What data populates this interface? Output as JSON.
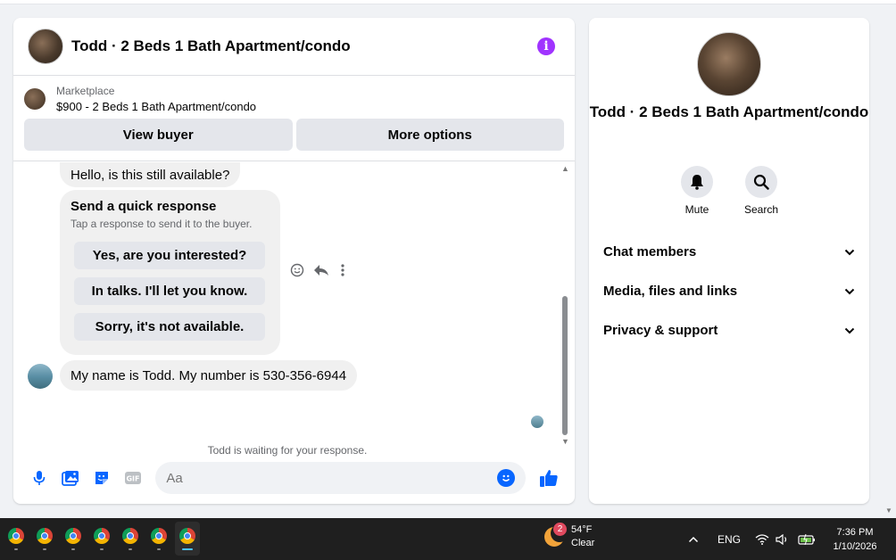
{
  "chat": {
    "title": "Todd · 2 Beds 1 Bath Apartment/condo",
    "marketplace_label": "Marketplace",
    "listing": "$900 - 2 Beds 1 Bath Apartment/condo",
    "view_buyer": "View buyer",
    "more_options": "More options",
    "messages": {
      "first": "Hello, is this still available?",
      "quick_title": "Send a quick response",
      "quick_sub": "Tap a response to send it to the buyer.",
      "quick_replies": [
        "Yes, are you interested?",
        "In talks. I'll let you know.",
        "Sorry, it's not available."
      ],
      "second": "My name is Todd. My number is 530-356-6944",
      "waiting": "Todd is waiting for your response."
    },
    "composer_placeholder": "Aa"
  },
  "info": {
    "name": "Todd · 2 Beds 1 Bath Apartment/condo",
    "mute": "Mute",
    "search": "Search",
    "sections": [
      "Chat members",
      "Media, files and links",
      "Privacy & support"
    ]
  },
  "taskbar": {
    "weather_badge": "2",
    "temperature": "54°F",
    "condition": "Clear",
    "language": "ENG",
    "time": "7:36 PM",
    "date": "1/10/2026"
  },
  "colors": {
    "accent": "#0866ff",
    "info_purple": "#a033ff",
    "bubble": "#f0f0f0"
  }
}
